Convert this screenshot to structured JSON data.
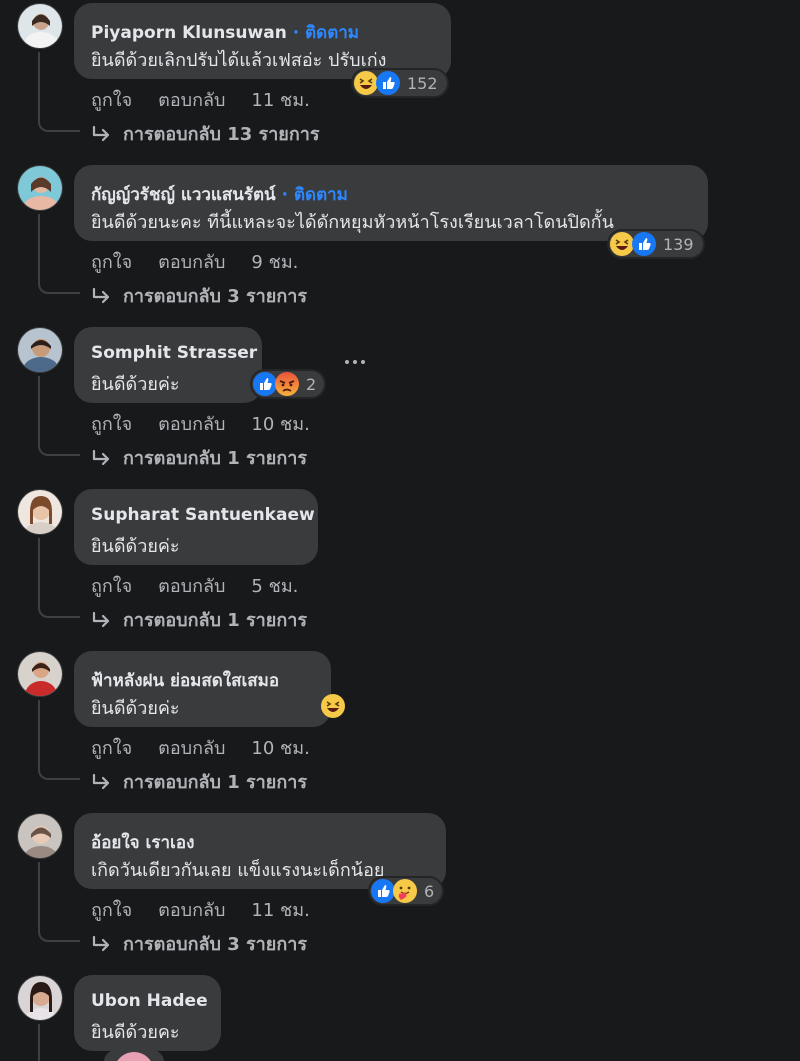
{
  "colors": {
    "page_bg": "#18191a",
    "bubble_bg": "#3a3b3c",
    "text_primary": "#e4e6eb",
    "text_secondary": "#b0b3b8",
    "follow_link": "#2d88ff"
  },
  "comments": [
    {
      "author": "Piyaporn Klunsuwan",
      "follow_label": "· ติดตาม",
      "text": "ยินดีด้วยเลิกปรับได้แล้วเฟสอ่ะ ปรับเก่ง",
      "reactions": [
        "haha-icon",
        "like-icon"
      ],
      "reaction_count": "152",
      "like_label": "ถูกใจ",
      "reply_label": "ตอบกลับ",
      "time": "11 ชม.",
      "replies_label": "การตอบกลับ 13 รายการ"
    },
    {
      "author": "กัญญ์วรัชญ์ แววแสนรัตน์",
      "follow_label": "· ติดตาม",
      "text": "ยินดีด้วยนะคะ ทีนี้แหละจะได้ดักหยุมหัวหน้าโรงเรียนเวลาโดนปิดกั้น",
      "reactions": [
        "haha-icon",
        "like-icon"
      ],
      "reaction_count": "139",
      "like_label": "ถูกใจ",
      "reply_label": "ตอบกลับ",
      "time": "9 ชม.",
      "replies_label": "การตอบกลับ 3 รายการ"
    },
    {
      "author": "Somphit Strasser",
      "follow_label": "",
      "text": "ยินดีด้วยค่ะ",
      "reactions": [
        "like-icon",
        "angry-icon"
      ],
      "reaction_count": "2",
      "like_label": "ถูกใจ",
      "reply_label": "ตอบกลับ",
      "time": "10 ชม.",
      "replies_label": "การตอบกลับ 1 รายการ"
    },
    {
      "author": "Supharat Santuenkaew",
      "follow_label": "",
      "text": "ยินดีด้วยค่ะ",
      "reactions": [],
      "reaction_count": "",
      "like_label": "ถูกใจ",
      "reply_label": "ตอบกลับ",
      "time": "5 ชม.",
      "replies_label": "การตอบกลับ 1 รายการ"
    },
    {
      "author": "ฟ้าหลังฝน ย่อมสดใสเสมอ",
      "follow_label": "",
      "text": "ยินดีด้วยค่ะ",
      "reactions": [
        "haha-icon"
      ],
      "reaction_count": "",
      "like_label": "ถูกใจ",
      "reply_label": "ตอบกลับ",
      "time": "10 ชม.",
      "replies_label": "การตอบกลับ 1 รายการ"
    },
    {
      "author": "อ้อยใจ เราเอง",
      "follow_label": "",
      "text": "เกิดวันเดียวกันเลย แข็งแรงนะเด็กน้อย",
      "reactions": [
        "like-icon",
        "care-icon"
      ],
      "reaction_count": "6",
      "like_label": "ถูกใจ",
      "reply_label": "ตอบกลับ",
      "time": "11 ชม.",
      "replies_label": "การตอบกลับ 3 รายการ"
    },
    {
      "author": "Ubon Hadee",
      "follow_label": "",
      "text": "ยินดีด้วยคะ",
      "reactions": [],
      "reaction_count": "",
      "like_label": "",
      "reply_label": "",
      "time": "",
      "replies_label": ""
    }
  ]
}
